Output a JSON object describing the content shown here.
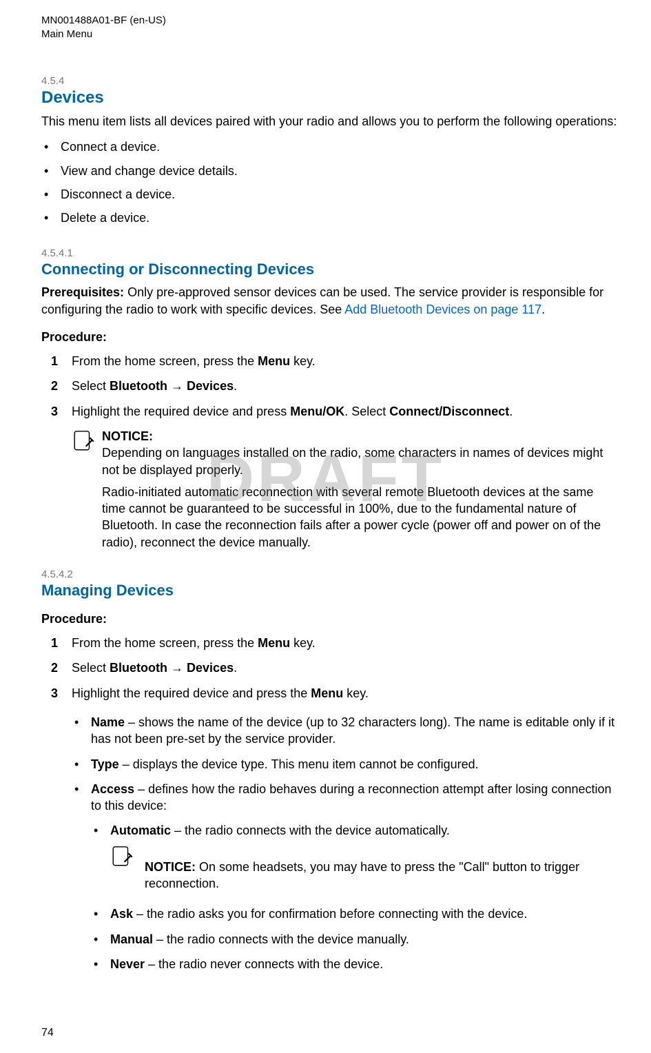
{
  "header": {
    "doc_id": "MN001488A01-BF (en-US)",
    "section_path": "Main Menu"
  },
  "watermark": "DRAFT",
  "page_number": "74",
  "sec_454": {
    "number": "4.5.4",
    "title": "Devices",
    "intro": "This menu item lists all devices paired with your radio and allows you to perform the following operations:",
    "bullets": [
      "Connect a device.",
      "View and change device details.",
      "Disconnect a device.",
      "Delete a device."
    ]
  },
  "sec_4541": {
    "number": "4.5.4.1",
    "title": "Connecting or Disconnecting Devices",
    "prereq_label": "Prerequisites: ",
    "prereq_text": "Only pre-approved sensor devices can be used. The service provider is responsible for configuring the radio to work with specific devices. See ",
    "prereq_link": "Add Bluetooth Devices on page 117",
    "prereq_end": ".",
    "procedure_label": "Procedure:",
    "steps": {
      "s1": {
        "pre": "From the home screen, press the ",
        "bold": "Menu",
        "post": " key."
      },
      "s2": {
        "pre": "Select ",
        "b1": "Bluetooth",
        "arrow": " → ",
        "b2": "Devices",
        "post": "."
      },
      "s3": {
        "pre": "Highlight the required device and press ",
        "b1": "Menu/OK",
        "mid": ". Select ",
        "b2": "Connect/Disconnect",
        "post": "."
      }
    },
    "notice": {
      "label": "NOTICE:",
      "p1": "Depending on languages installed on the radio, some characters in names of devices might not be displayed properly.",
      "p2": "Radio-initiated automatic reconnection with several remote Bluetooth devices at the same time cannot be guaranteed to be successful in 100%, due to the fundamental nature of Bluetooth. In case the reconnection fails after a power cycle (power off and power on of the radio), reconnect the device manually."
    }
  },
  "sec_4542": {
    "number": "4.5.4.2",
    "title": "Managing Devices",
    "procedure_label": "Procedure:",
    "steps": {
      "s1": {
        "pre": "From the home screen, press the ",
        "bold": "Menu",
        "post": " key."
      },
      "s2": {
        "pre": "Select ",
        "b1": "Bluetooth",
        "arrow": " → ",
        "b2": "Devices",
        "post": "."
      },
      "s3": {
        "pre": "Highlight the required device and press the ",
        "bold": "Menu",
        "post": " key."
      }
    },
    "options": {
      "name": {
        "bold": "Name",
        "text": " – shows the name of the device (up to 32 characters long). The name is editable only if it has not been pre-set by the service provider."
      },
      "type": {
        "bold": "Type",
        "text": " – displays the device type. This menu item cannot be configured."
      },
      "access": {
        "bold": "Access",
        "text": " – defines how the radio behaves during a reconnection attempt after losing connection to this device:"
      },
      "automatic": {
        "bold": "Automatic",
        "text": " – the radio connects with the device automatically."
      },
      "automatic_notice": {
        "label": "NOTICE: ",
        "text": "On some headsets, you may have to press the \"Call\" button to trigger reconnection."
      },
      "ask": {
        "bold": "Ask",
        "text": " – the radio asks you for confirmation before connecting with the device."
      },
      "manual": {
        "bold": "Manual",
        "text": " – the radio connects with the device manually."
      },
      "never": {
        "bold": "Never",
        "text": " – the radio never connects with the device."
      }
    }
  }
}
